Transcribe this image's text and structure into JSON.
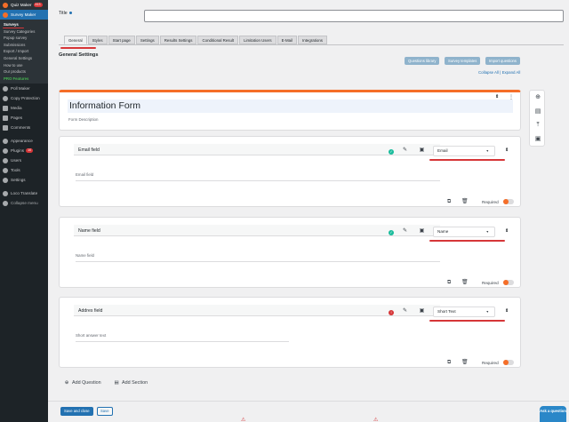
{
  "sidebar": {
    "top": {
      "label": "Quiz Maker",
      "badge": "413"
    },
    "active": {
      "label": "Survey Maker"
    },
    "submenu": [
      "Surveys",
      "Survey Categories",
      "Popup survey",
      "Submissions",
      "Export / Import",
      "General Settings",
      "How to use",
      "Our products",
      "PRO Features"
    ],
    "items": [
      "Poll Maker",
      "Copy Protection",
      "Media",
      "Pages",
      "Comments",
      "Appearance",
      "Plugins",
      "Users",
      "Tools",
      "Settings",
      "Loco Translate",
      "Collapse menu"
    ],
    "plugins_badge": "10"
  },
  "form": {
    "title_label": "Title",
    "tabs": [
      "General",
      "Styles",
      "Start page",
      "Settings",
      "Results Settings",
      "Conditional Result",
      "Limitation Users",
      "E-Mail",
      "Integrations"
    ],
    "section_title": "General Settings",
    "actions": [
      "Questions library",
      "Survey templates",
      "Import questions"
    ],
    "collapse_all": "Collapse All",
    "expand_all": "Expand All",
    "link_separator": "|",
    "info_title": "Information Form",
    "info_description": "Form Description"
  },
  "questions": [
    {
      "label": "Email field",
      "type": "Email",
      "placeholder": "Email field",
      "status_color": "#1abc9c"
    },
    {
      "label": "Name field",
      "type": "Name",
      "placeholder": "Name field",
      "status_color": "#1abc9c"
    },
    {
      "label": "Addres field",
      "type": "Short Text",
      "placeholder": "Short answer text",
      "status_color": "#d63638"
    }
  ],
  "required_label": "Required",
  "add_question": "Add Question",
  "add_section": "Add Section",
  "save_close": "Save and close",
  "save": "Save",
  "ask_question": "Ask a question",
  "colors": {
    "accent": "#f56e28",
    "primary": "#2271b1",
    "sidebar": "#1d2327",
    "highlight": "#d63638"
  }
}
